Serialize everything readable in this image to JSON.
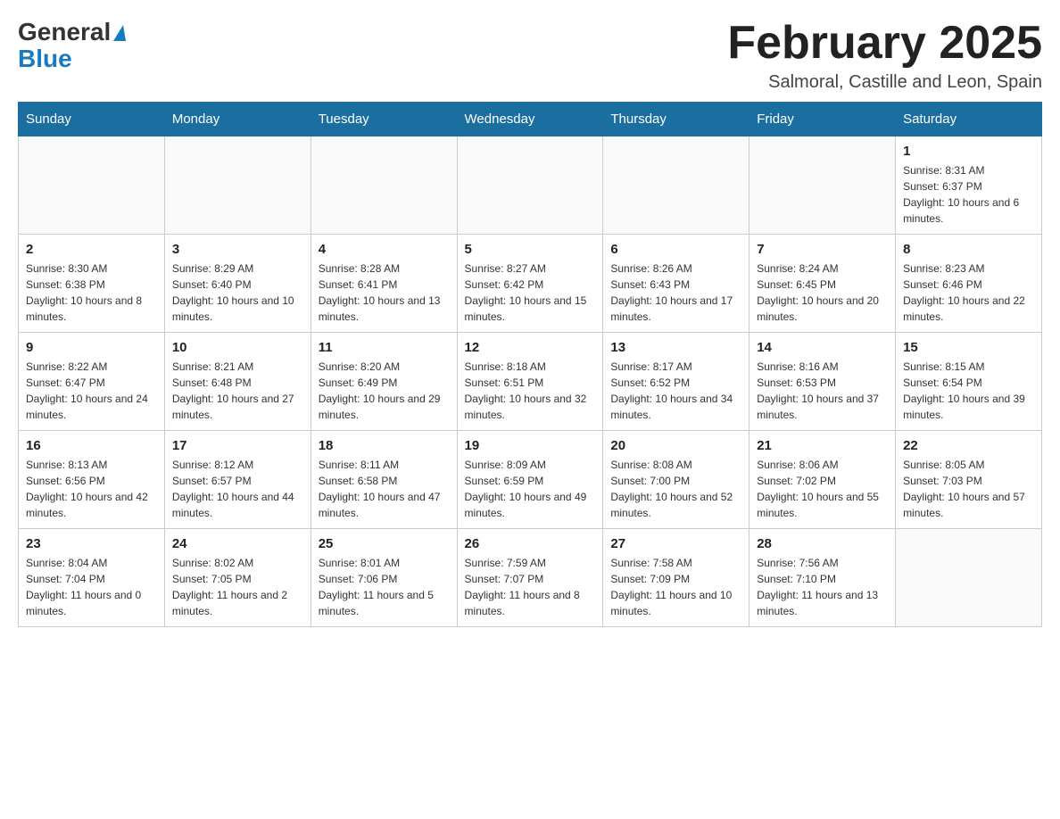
{
  "header": {
    "logo_general": "General",
    "logo_blue": "Blue",
    "month_title": "February 2025",
    "subtitle": "Salmoral, Castille and Leon, Spain"
  },
  "weekdays": [
    "Sunday",
    "Monday",
    "Tuesday",
    "Wednesday",
    "Thursday",
    "Friday",
    "Saturday"
  ],
  "weeks": [
    [
      {
        "day": "",
        "info": ""
      },
      {
        "day": "",
        "info": ""
      },
      {
        "day": "",
        "info": ""
      },
      {
        "day": "",
        "info": ""
      },
      {
        "day": "",
        "info": ""
      },
      {
        "day": "",
        "info": ""
      },
      {
        "day": "1",
        "info": "Sunrise: 8:31 AM\nSunset: 6:37 PM\nDaylight: 10 hours and 6 minutes."
      }
    ],
    [
      {
        "day": "2",
        "info": "Sunrise: 8:30 AM\nSunset: 6:38 PM\nDaylight: 10 hours and 8 minutes."
      },
      {
        "day": "3",
        "info": "Sunrise: 8:29 AM\nSunset: 6:40 PM\nDaylight: 10 hours and 10 minutes."
      },
      {
        "day": "4",
        "info": "Sunrise: 8:28 AM\nSunset: 6:41 PM\nDaylight: 10 hours and 13 minutes."
      },
      {
        "day": "5",
        "info": "Sunrise: 8:27 AM\nSunset: 6:42 PM\nDaylight: 10 hours and 15 minutes."
      },
      {
        "day": "6",
        "info": "Sunrise: 8:26 AM\nSunset: 6:43 PM\nDaylight: 10 hours and 17 minutes."
      },
      {
        "day": "7",
        "info": "Sunrise: 8:24 AM\nSunset: 6:45 PM\nDaylight: 10 hours and 20 minutes."
      },
      {
        "day": "8",
        "info": "Sunrise: 8:23 AM\nSunset: 6:46 PM\nDaylight: 10 hours and 22 minutes."
      }
    ],
    [
      {
        "day": "9",
        "info": "Sunrise: 8:22 AM\nSunset: 6:47 PM\nDaylight: 10 hours and 24 minutes."
      },
      {
        "day": "10",
        "info": "Sunrise: 8:21 AM\nSunset: 6:48 PM\nDaylight: 10 hours and 27 minutes."
      },
      {
        "day": "11",
        "info": "Sunrise: 8:20 AM\nSunset: 6:49 PM\nDaylight: 10 hours and 29 minutes."
      },
      {
        "day": "12",
        "info": "Sunrise: 8:18 AM\nSunset: 6:51 PM\nDaylight: 10 hours and 32 minutes."
      },
      {
        "day": "13",
        "info": "Sunrise: 8:17 AM\nSunset: 6:52 PM\nDaylight: 10 hours and 34 minutes."
      },
      {
        "day": "14",
        "info": "Sunrise: 8:16 AM\nSunset: 6:53 PM\nDaylight: 10 hours and 37 minutes."
      },
      {
        "day": "15",
        "info": "Sunrise: 8:15 AM\nSunset: 6:54 PM\nDaylight: 10 hours and 39 minutes."
      }
    ],
    [
      {
        "day": "16",
        "info": "Sunrise: 8:13 AM\nSunset: 6:56 PM\nDaylight: 10 hours and 42 minutes."
      },
      {
        "day": "17",
        "info": "Sunrise: 8:12 AM\nSunset: 6:57 PM\nDaylight: 10 hours and 44 minutes."
      },
      {
        "day": "18",
        "info": "Sunrise: 8:11 AM\nSunset: 6:58 PM\nDaylight: 10 hours and 47 minutes."
      },
      {
        "day": "19",
        "info": "Sunrise: 8:09 AM\nSunset: 6:59 PM\nDaylight: 10 hours and 49 minutes."
      },
      {
        "day": "20",
        "info": "Sunrise: 8:08 AM\nSunset: 7:00 PM\nDaylight: 10 hours and 52 minutes."
      },
      {
        "day": "21",
        "info": "Sunrise: 8:06 AM\nSunset: 7:02 PM\nDaylight: 10 hours and 55 minutes."
      },
      {
        "day": "22",
        "info": "Sunrise: 8:05 AM\nSunset: 7:03 PM\nDaylight: 10 hours and 57 minutes."
      }
    ],
    [
      {
        "day": "23",
        "info": "Sunrise: 8:04 AM\nSunset: 7:04 PM\nDaylight: 11 hours and 0 minutes."
      },
      {
        "day": "24",
        "info": "Sunrise: 8:02 AM\nSunset: 7:05 PM\nDaylight: 11 hours and 2 minutes."
      },
      {
        "day": "25",
        "info": "Sunrise: 8:01 AM\nSunset: 7:06 PM\nDaylight: 11 hours and 5 minutes."
      },
      {
        "day": "26",
        "info": "Sunrise: 7:59 AM\nSunset: 7:07 PM\nDaylight: 11 hours and 8 minutes."
      },
      {
        "day": "27",
        "info": "Sunrise: 7:58 AM\nSunset: 7:09 PM\nDaylight: 11 hours and 10 minutes."
      },
      {
        "day": "28",
        "info": "Sunrise: 7:56 AM\nSunset: 7:10 PM\nDaylight: 11 hours and 13 minutes."
      },
      {
        "day": "",
        "info": ""
      }
    ]
  ]
}
